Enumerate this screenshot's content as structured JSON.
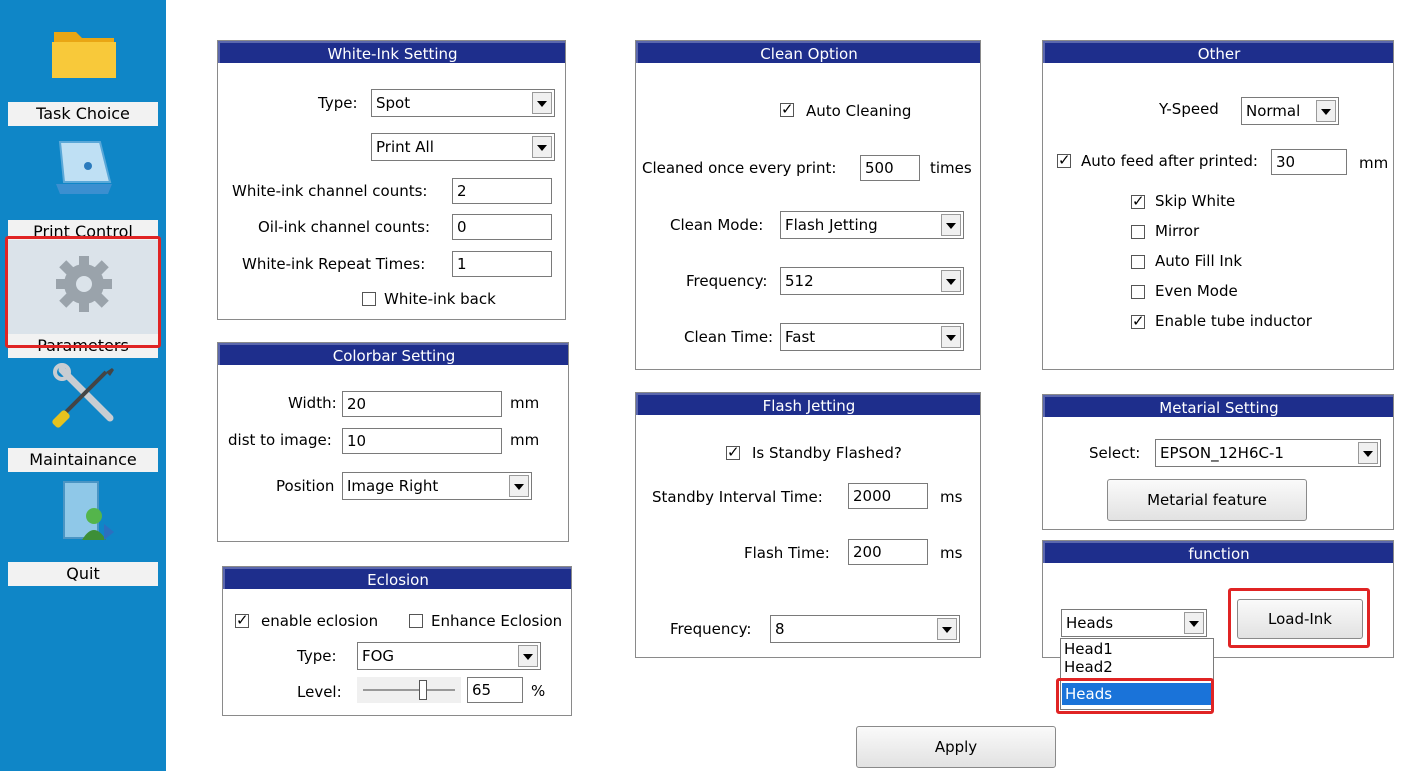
{
  "sidebar": {
    "items": [
      {
        "label": "Task Choice",
        "icon": "folder-icon"
      },
      {
        "label": "Print Control",
        "icon": "printer-icon"
      },
      {
        "label": "Parameters",
        "icon": "gear-icon"
      },
      {
        "label": "Maintainance",
        "icon": "tools-icon"
      },
      {
        "label": "Quit",
        "icon": "quit-user-icon"
      }
    ],
    "selected": "Parameters"
  },
  "white_ink": {
    "title": "White-Ink Setting",
    "type_label": "Type:",
    "type_value": "Spot",
    "print_value": "Print All",
    "channel_label": "White-ink channel counts:",
    "channel_value": "2",
    "oil_label": "Oil-ink channel counts:",
    "oil_value": "0",
    "repeat_label": "White-ink Repeat Times:",
    "repeat_value": "1",
    "back_label": "White-ink back",
    "back_checked": false
  },
  "colorbar": {
    "title": "Colorbar Setting",
    "width_label": "Width:",
    "width_value": "20",
    "width_unit": "mm",
    "dist_label": "dist to image:",
    "dist_value": "10",
    "dist_unit": "mm",
    "position_label": "Position",
    "position_value": "Image Right"
  },
  "eclosion": {
    "title": "Eclosion",
    "enable_label": "enable eclosion",
    "enable_checked": true,
    "enhance_label": "Enhance Eclosion",
    "enhance_checked": false,
    "type_label": "Type:",
    "type_value": "FOG",
    "level_label": "Level:",
    "level_value": "65",
    "level_unit": "%",
    "level_fraction": 0.65
  },
  "clean": {
    "title": "Clean Option",
    "auto_label": "Auto Cleaning",
    "auto_checked": true,
    "every_label": "Cleaned once every print:",
    "every_value": "500",
    "every_unit": "times",
    "mode_label": "Clean Mode:",
    "mode_value": "Flash Jetting",
    "freq_label": "Frequency:",
    "freq_value": "512",
    "time_label": "Clean Time:",
    "time_value": "Fast"
  },
  "flash": {
    "title": "Flash Jetting",
    "standby_label": "Is Standby Flashed?",
    "standby_checked": true,
    "interval_label": "Standby Interval Time:",
    "interval_value": "2000",
    "interval_unit": "ms",
    "flash_time_label": "Flash Time:",
    "flash_time_value": "200",
    "flash_time_unit": "ms",
    "freq_label": "Frequency:",
    "freq_value": "8"
  },
  "other": {
    "title": "Other",
    "yspeed_label": "Y-Speed",
    "yspeed_value": "Normal",
    "autofeed_label": "Auto feed after printed:",
    "autofeed_checked": true,
    "autofeed_value": "30",
    "autofeed_unit": "mm",
    "options": [
      {
        "label": "Skip White",
        "checked": true
      },
      {
        "label": "Mirror",
        "checked": false
      },
      {
        "label": "Auto Fill Ink",
        "checked": false
      },
      {
        "label": "Even Mode",
        "checked": false
      },
      {
        "label": "Enable tube inductor",
        "checked": true
      }
    ]
  },
  "material": {
    "title": "Metarial Setting",
    "select_label": "Select:",
    "select_value": "EPSON_12H6C-1",
    "feature_button": "Metarial feature"
  },
  "function": {
    "title": "function",
    "heads_value": "Heads",
    "options": [
      "Head1",
      "Head2",
      "Heads"
    ],
    "highlighted_option": "Heads",
    "load_ink_button": "Load-Ink"
  },
  "apply_button": "Apply",
  "colors": {
    "sidebar_bg": "#0f86c7",
    "title_bar": "#1e2e8c",
    "highlight": "#e02424",
    "selection": "#1a73d9"
  }
}
